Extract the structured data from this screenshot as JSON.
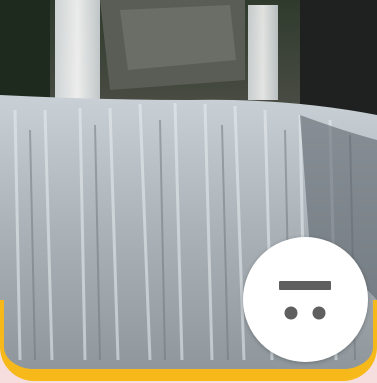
{
  "photo": {
    "subject_icon": "waterfall-photo"
  },
  "action_button": {
    "icon": "remove-card-icon"
  },
  "colors": {
    "accent": "#f7b81a",
    "page_background": "#f7dede",
    "button_background": "#ffffff",
    "icon_color": "#5f5f5f"
  }
}
